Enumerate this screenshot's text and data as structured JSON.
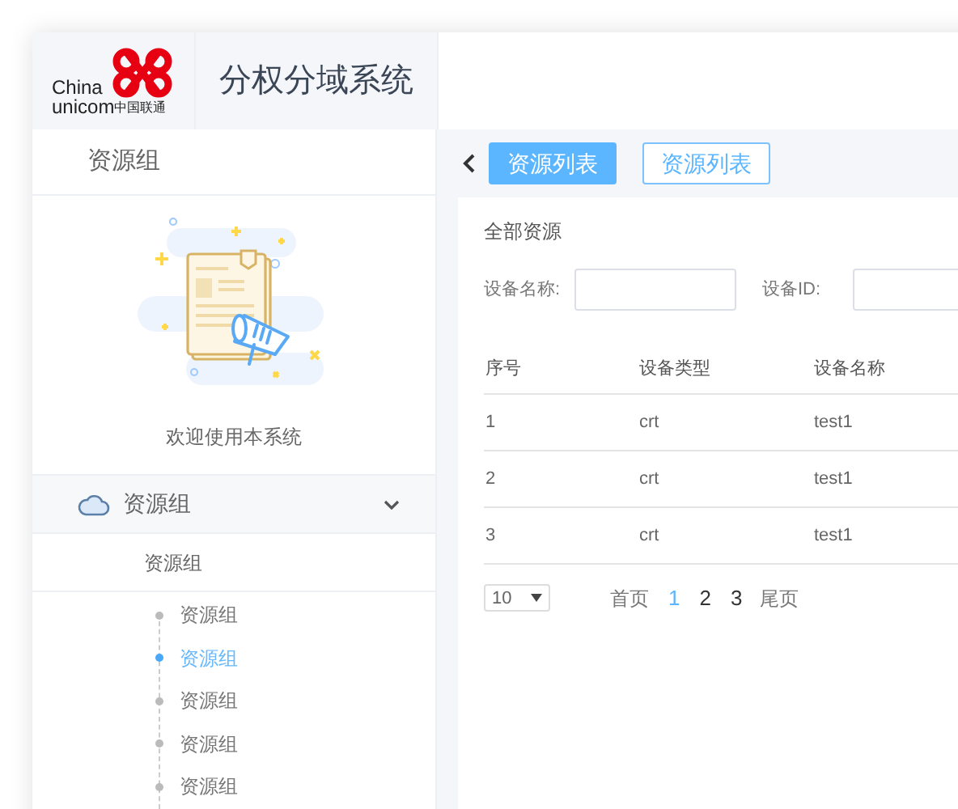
{
  "logo": {
    "line_1": "China",
    "line_2": "unicom",
    "line_3": "中国联通"
  },
  "app_title": "分权分域系统",
  "sidebar": {
    "heading": "资源组",
    "welcome": "欢迎使用本系统",
    "group": {
      "label": "资源组",
      "expanded": true,
      "children": [
        {
          "label": "资源组",
          "children": [
            {
              "label": "资源组",
              "selected": false
            },
            {
              "label": "资源组",
              "selected": true
            },
            {
              "label": "资源组",
              "selected": false
            },
            {
              "label": "资源组",
              "selected": false
            },
            {
              "label": "资源组",
              "selected": false
            }
          ]
        }
      ]
    }
  },
  "tabs": [
    {
      "label": "资源列表",
      "selected": true
    },
    {
      "label": "资源列表",
      "selected": false
    }
  ],
  "panel": {
    "title": "全部资源",
    "filters": [
      {
        "label": "设备名称:"
      },
      {
        "label": "设备ID:"
      }
    ],
    "table": {
      "columns": [
        "序号",
        "设备类型",
        "设备名称"
      ],
      "rows": [
        [
          "1",
          "crt",
          "test1"
        ],
        [
          "2",
          "crt",
          "test1"
        ],
        [
          "3",
          "crt",
          "test1"
        ]
      ]
    },
    "pagination": {
      "page_size": "10",
      "first": "首页",
      "last": "尾页",
      "pages": [
        {
          "label": "1",
          "selected": true
        },
        {
          "label": "2",
          "selected": false
        },
        {
          "label": "3",
          "selected": false
        }
      ]
    }
  }
}
